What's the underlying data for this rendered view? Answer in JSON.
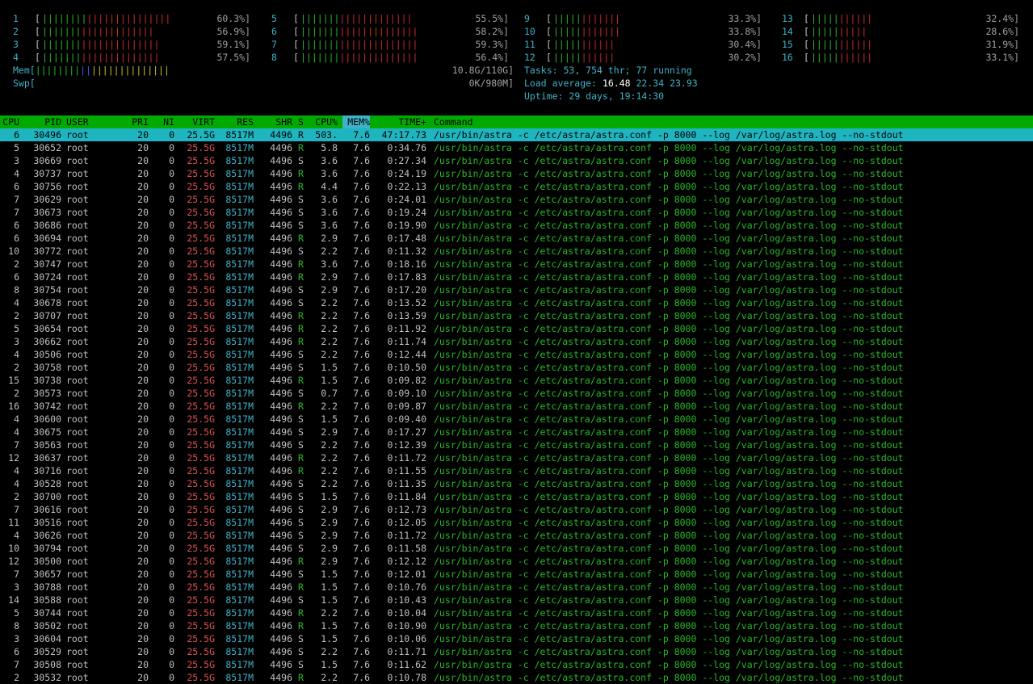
{
  "cpus": [
    {
      "id": "1",
      "pct": "60.3%]",
      "g": 8,
      "r": 15
    },
    {
      "id": "2",
      "pct": "56.9%]",
      "g": 7,
      "r": 13
    },
    {
      "id": "3",
      "pct": "59.1%]",
      "g": 7,
      "r": 14
    },
    {
      "id": "4",
      "pct": "57.5%]",
      "g": 7,
      "r": 14
    },
    {
      "id": "5",
      "pct": "55.5%]",
      "g": 7,
      "r": 13
    },
    {
      "id": "6",
      "pct": "58.2%]",
      "g": 7,
      "r": 14
    },
    {
      "id": "7",
      "pct": "59.3%]",
      "g": 7,
      "r": 14
    },
    {
      "id": "8",
      "pct": "56.4%]",
      "g": 7,
      "r": 14
    },
    {
      "id": "9",
      "pct": "33.3%]",
      "g": 5,
      "r": 7
    },
    {
      "id": "10",
      "pct": "33.8%]",
      "g": 5,
      "r": 7
    },
    {
      "id": "11",
      "pct": "30.4%]",
      "g": 5,
      "r": 6
    },
    {
      "id": "12",
      "pct": "30.2%]",
      "g": 5,
      "r": 6
    },
    {
      "id": "13",
      "pct": "32.4%]",
      "g": 5,
      "r": 6
    },
    {
      "id": "14",
      "pct": "28.6%]",
      "g": 5,
      "r": 5
    },
    {
      "id": "15",
      "pct": "31.9%]",
      "g": 5,
      "r": 6
    },
    {
      "id": "16",
      "pct": "33.1%]",
      "g": 5,
      "r": 6
    }
  ],
  "mem": {
    "label": "Mem[",
    "value": "10.8G/110G]"
  },
  "swp": {
    "label": "Swp[",
    "value": "0K/980M]"
  },
  "summary": {
    "tasks_label": "Tasks: ",
    "tasks": "53, 754 thr; 77 running",
    "load_label": "Load average: ",
    "load1": "16.48",
    "load5": "22.34",
    "load15": "23.93",
    "uptime_label": "Uptime: ",
    "uptime": "29 days, 19:14:30"
  },
  "header": {
    "cpu": "CPU",
    "pid": "PID",
    "user": "USER",
    "pri": "PRI",
    "ni": "NI",
    "virt": "VIRT",
    "res": "RES",
    "shr": "SHR",
    "s": "S",
    "cpup": "CPU%",
    "mem": "MEM%",
    "time": "TIME+",
    "cmd": "Command"
  },
  "common": {
    "user": "root",
    "pri": "20",
    "ni": "0",
    "virt": "25.5G",
    "res": "8517M",
    "shr": "4496",
    "mem": "7.6",
    "cmd": "/usr/bin/astra -c /etc/astra/astra.conf -p 8000 --log /var/log/astra.log --no-stdout"
  },
  "rows": [
    [
      "6",
      "30496",
      "R",
      "503.",
      "47:17.73"
    ],
    [
      "5",
      "30652",
      "R",
      "5.8",
      "0:34.76"
    ],
    [
      "3",
      "30669",
      "S",
      "3.6",
      "0:27.34"
    ],
    [
      "4",
      "30737",
      "R",
      "3.6",
      "0:24.19"
    ],
    [
      "6",
      "30756",
      "R",
      "4.4",
      "0:22.13"
    ],
    [
      "7",
      "30629",
      "S",
      "3.6",
      "0:24.01"
    ],
    [
      "7",
      "30673",
      "S",
      "3.6",
      "0:19.24"
    ],
    [
      "6",
      "30686",
      "S",
      "3.6",
      "0:19.90"
    ],
    [
      "6",
      "30694",
      "R",
      "2.9",
      "0:17.48"
    ],
    [
      "10",
      "30772",
      "S",
      "2.2",
      "0:11.32"
    ],
    [
      "2",
      "30747",
      "R",
      "3.6",
      "0:18.16"
    ],
    [
      "6",
      "30724",
      "R",
      "2.9",
      "0:17.83"
    ],
    [
      "8",
      "30754",
      "S",
      "2.9",
      "0:17.20"
    ],
    [
      "4",
      "30678",
      "S",
      "2.2",
      "0:13.52"
    ],
    [
      "2",
      "30707",
      "R",
      "2.2",
      "0:13.59"
    ],
    [
      "5",
      "30654",
      "R",
      "2.2",
      "0:11.92"
    ],
    [
      "3",
      "30662",
      "R",
      "2.2",
      "0:11.74"
    ],
    [
      "4",
      "30506",
      "S",
      "2.2",
      "0:12.44"
    ],
    [
      "2",
      "30758",
      "S",
      "1.5",
      "0:10.50"
    ],
    [
      "15",
      "30738",
      "R",
      "1.5",
      "0:09.82"
    ],
    [
      "2",
      "30573",
      "S",
      "0.7",
      "0:09.10"
    ],
    [
      "16",
      "30742",
      "R",
      "2.2",
      "0:09.87"
    ],
    [
      "4",
      "30600",
      "S",
      "1.5",
      "0:09.40"
    ],
    [
      "4",
      "30675",
      "S",
      "2.9",
      "0:17.27"
    ],
    [
      "7",
      "30563",
      "S",
      "2.2",
      "0:12.39"
    ],
    [
      "12",
      "30637",
      "R",
      "2.2",
      "0:11.72"
    ],
    [
      "4",
      "30716",
      "R",
      "2.2",
      "0:11.55"
    ],
    [
      "4",
      "30528",
      "S",
      "2.2",
      "0:11.35"
    ],
    [
      "2",
      "30700",
      "S",
      "1.5",
      "0:11.84"
    ],
    [
      "7",
      "30616",
      "S",
      "2.9",
      "0:12.73"
    ],
    [
      "11",
      "30516",
      "S",
      "2.9",
      "0:12.05"
    ],
    [
      "4",
      "30626",
      "S",
      "2.9",
      "0:11.72"
    ],
    [
      "10",
      "30794",
      "S",
      "2.9",
      "0:11.58"
    ],
    [
      "12",
      "30500",
      "R",
      "2.9",
      "0:12.12"
    ],
    [
      "7",
      "30657",
      "S",
      "1.5",
      "0:12.01"
    ],
    [
      "3",
      "30788",
      "R",
      "1.5",
      "0:10.76"
    ],
    [
      "14",
      "30588",
      "S",
      "1.5",
      "0:10.43"
    ],
    [
      "5",
      "30744",
      "R",
      "2.2",
      "0:10.04"
    ],
    [
      "8",
      "30502",
      "R",
      "1.5",
      "0:10.90"
    ],
    [
      "3",
      "30604",
      "S",
      "1.5",
      "0:10.06"
    ],
    [
      "6",
      "30529",
      "S",
      "2.2",
      "0:11.71"
    ],
    [
      "7",
      "30508",
      "S",
      "1.5",
      "0:11.62"
    ],
    [
      "2",
      "30532",
      "R",
      "2.2",
      "0:10.78"
    ]
  ],
  "colors": {
    "accent": "#00aa00",
    "selection": "#1fb5c0",
    "cyan": "#3fb2c6",
    "green": "#28b828",
    "red": "#d02a2a"
  }
}
